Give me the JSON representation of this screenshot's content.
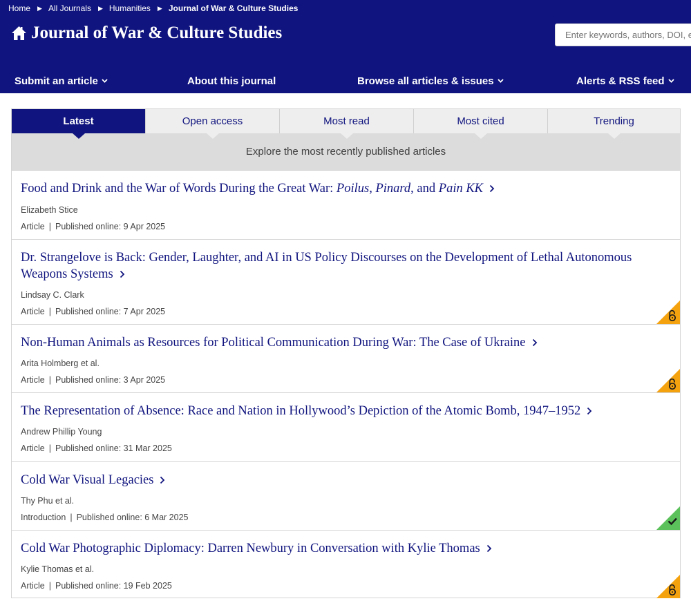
{
  "breadcrumb": {
    "items": [
      "Home",
      "All Journals",
      "Humanities",
      "Journal of War & Culture Studies"
    ],
    "separator": "▶"
  },
  "header": {
    "title": "Journal of War & Culture Studies",
    "home_icon": "home-icon",
    "search_placeholder": "Enter keywords, authors, DOI, etc",
    "background_color": "#10147e"
  },
  "nav": {
    "items": [
      {
        "label": "Submit an article",
        "has_dropdown": true
      },
      {
        "label": "About this journal",
        "has_dropdown": false
      },
      {
        "label": "Browse all articles & issues",
        "has_dropdown": true
      },
      {
        "label": "Alerts & RSS feed",
        "has_dropdown": true
      }
    ]
  },
  "tabs": {
    "items": [
      {
        "label": "Latest",
        "active": true
      },
      {
        "label": "Open access",
        "active": false
      },
      {
        "label": "Most read",
        "active": false
      },
      {
        "label": "Most cited",
        "active": false
      },
      {
        "label": "Trending",
        "active": false
      }
    ],
    "description": "Explore the most recently published articles"
  },
  "articles": [
    {
      "title_parts": [
        {
          "text": "Food and Drink and the War of Words During the Great War: ",
          "italic": false
        },
        {
          "text": "Poilus",
          "italic": true
        },
        {
          "text": ", ",
          "italic": false
        },
        {
          "text": "Pinard",
          "italic": true
        },
        {
          "text": ", and ",
          "italic": false
        },
        {
          "text": "Pain KK",
          "italic": true
        }
      ],
      "authors": "Elizabeth Stice",
      "type": "Article",
      "published": "Published online: 9 Apr 2025",
      "badge": null
    },
    {
      "title_parts": [
        {
          "text": "Dr. Strangelove is Back: Gender, Laughter, and AI in US Policy Discourses on the Development of Lethal Autonomous Weapons Systems",
          "italic": false
        }
      ],
      "authors": "Lindsay C. Clark",
      "type": "Article",
      "published": "Published online: 7 Apr 2025",
      "badge": "open-access"
    },
    {
      "title_parts": [
        {
          "text": "Non-Human Animals as Resources for Political Communication During War: The Case of Ukraine",
          "italic": false
        }
      ],
      "authors": "Arita Holmberg et al.",
      "type": "Article",
      "published": "Published online: 3 Apr 2025",
      "badge": "open-access"
    },
    {
      "title_parts": [
        {
          "text": "The Representation of Absence: Race and Nation in Hollywood’s Depiction of the Atomic Bomb, 1947–1952",
          "italic": false
        }
      ],
      "authors": "Andrew Phillip Young",
      "type": "Article",
      "published": "Published online: 31 Mar 2025",
      "badge": null
    },
    {
      "title_parts": [
        {
          "text": "Cold War Visual Legacies",
          "italic": false
        }
      ],
      "authors": "Thy Phu et al.",
      "type": "Introduction",
      "published": "Published online: 6 Mar 2025",
      "badge": "free-access"
    },
    {
      "title_parts": [
        {
          "text": "Cold War Photographic Diplomacy: Darren Newbury in Conversation with Kylie Thomas",
          "italic": false
        }
      ],
      "authors": "Kylie Thomas et al.",
      "type": "Article",
      "published": "Published online: 19 Feb 2025",
      "badge": "open-access"
    }
  ],
  "colors": {
    "brand_navy": "#10147e",
    "open_access_badge": "#f5a20f",
    "free_access_badge": "#5bc25b",
    "tab_inactive_bg": "#eeeeee",
    "description_bg": "#dcdcdc"
  }
}
